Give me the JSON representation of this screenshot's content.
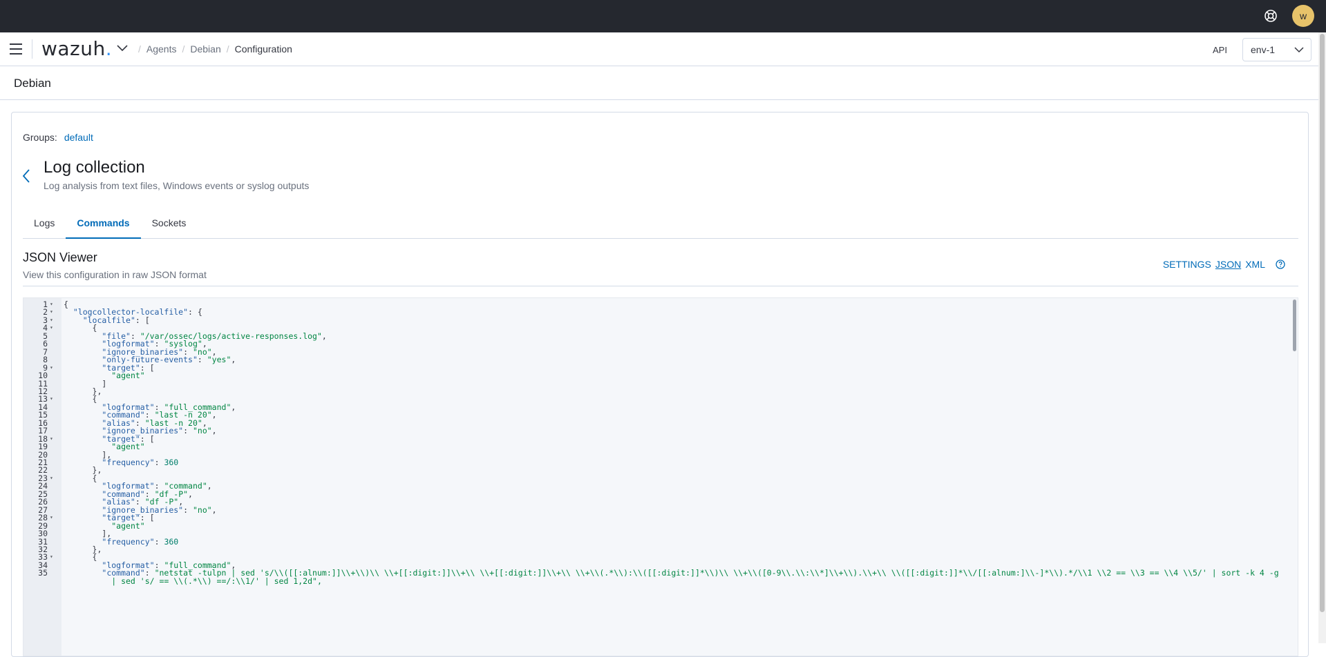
{
  "topbar": {
    "avatar_letter": "w"
  },
  "nav": {
    "logo_text": "wazuh",
    "logo_dot": ".",
    "breadcrumb": [
      "Agents",
      "Debian",
      "Configuration"
    ],
    "api_label": "API",
    "env_value": "env-1"
  },
  "header": {
    "agent_name": "Debian"
  },
  "panel": {
    "groups_label": "Groups:",
    "groups_value": "default",
    "title": "Log collection",
    "description": "Log analysis from text files, Windows events or syslog outputs",
    "tabs": [
      "Logs",
      "Commands",
      "Sockets"
    ],
    "active_tab": "Commands",
    "viewer_title": "JSON Viewer",
    "viewer_desc": "View this configuration in raw JSON format",
    "actions": {
      "settings": "SETTINGS",
      "json": "JSON",
      "xml": "XML"
    }
  },
  "code_lines": [
    {
      "n": "1",
      "fold": true,
      "t": "{"
    },
    {
      "n": "2",
      "fold": true,
      "t": "  \"logcollector-localfile\": {"
    },
    {
      "n": "3",
      "fold": true,
      "t": "    \"localfile\": ["
    },
    {
      "n": "4",
      "fold": true,
      "t": "      {"
    },
    {
      "n": "5",
      "fold": false,
      "t": "        \"file\": \"/var/ossec/logs/active-responses.log\","
    },
    {
      "n": "6",
      "fold": false,
      "t": "        \"logformat\": \"syslog\","
    },
    {
      "n": "7",
      "fold": false,
      "t": "        \"ignore_binaries\": \"no\","
    },
    {
      "n": "8",
      "fold": false,
      "t": "        \"only-future-events\": \"yes\","
    },
    {
      "n": "9",
      "fold": true,
      "t": "        \"target\": ["
    },
    {
      "n": "10",
      "fold": false,
      "t": "          \"agent\""
    },
    {
      "n": "11",
      "fold": false,
      "t": "        ]"
    },
    {
      "n": "12",
      "fold": false,
      "t": "      },"
    },
    {
      "n": "13",
      "fold": true,
      "t": "      {"
    },
    {
      "n": "14",
      "fold": false,
      "t": "        \"logformat\": \"full_command\","
    },
    {
      "n": "15",
      "fold": false,
      "t": "        \"command\": \"last -n 20\","
    },
    {
      "n": "16",
      "fold": false,
      "t": "        \"alias\": \"last -n 20\","
    },
    {
      "n": "17",
      "fold": false,
      "t": "        \"ignore_binaries\": \"no\","
    },
    {
      "n": "18",
      "fold": true,
      "t": "        \"target\": ["
    },
    {
      "n": "19",
      "fold": false,
      "t": "          \"agent\""
    },
    {
      "n": "20",
      "fold": false,
      "t": "        ],"
    },
    {
      "n": "21",
      "fold": false,
      "t": "        \"frequency\": 360"
    },
    {
      "n": "22",
      "fold": false,
      "t": "      },"
    },
    {
      "n": "23",
      "fold": true,
      "t": "      {"
    },
    {
      "n": "24",
      "fold": false,
      "t": "        \"logformat\": \"command\","
    },
    {
      "n": "25",
      "fold": false,
      "t": "        \"command\": \"df -P\","
    },
    {
      "n": "26",
      "fold": false,
      "t": "        \"alias\": \"df -P\","
    },
    {
      "n": "27",
      "fold": false,
      "t": "        \"ignore_binaries\": \"no\","
    },
    {
      "n": "28",
      "fold": true,
      "t": "        \"target\": ["
    },
    {
      "n": "29",
      "fold": false,
      "t": "          \"agent\""
    },
    {
      "n": "30",
      "fold": false,
      "t": "        ],"
    },
    {
      "n": "31",
      "fold": false,
      "t": "        \"frequency\": 360"
    },
    {
      "n": "32",
      "fold": false,
      "t": "      },"
    },
    {
      "n": "33",
      "fold": true,
      "t": "      {"
    },
    {
      "n": "34",
      "fold": false,
      "t": "        \"logformat\": \"full_command\","
    },
    {
      "n": "35",
      "fold": false,
      "t": "        \"command\": \"netstat -tulpn | sed 's/\\\\([[:alnum:]]\\\\+\\\\)\\\\ \\\\+[[:digit:]]\\\\+\\\\ \\\\+[[:digit:]]\\\\+\\\\ \\\\+\\\\(.*\\\\):\\\\([[:digit:]]*\\\\)\\\\ \\\\+\\\\([0-9\\\\.\\\\:\\\\*]\\\\+\\\\).\\\\+\\\\ \\\\([[:digit:]]*\\\\/[[:alnum:]\\\\-]*\\\\).*/\\\\1 \\\\2 == \\\\3 == \\\\4 \\\\5/' | sort -k 4 -g"
    },
    {
      "n": "",
      "fold": false,
      "t": "          | sed 's/ == \\\\(.*\\\\) ==/:\\\\1/' | sed 1,2d\","
    }
  ],
  "colors": {
    "topbar": "#25282f",
    "link": "#006bb8",
    "avatar": "#e7c36a",
    "json_key": "#255ea4",
    "json_string": "#008542",
    "json_number": "#007e6a"
  },
  "icons": {
    "help": "help-ring-icon",
    "menu": "hamburger-menu-icon",
    "back": "chevron-left-icon",
    "question": "question-circle-icon"
  }
}
